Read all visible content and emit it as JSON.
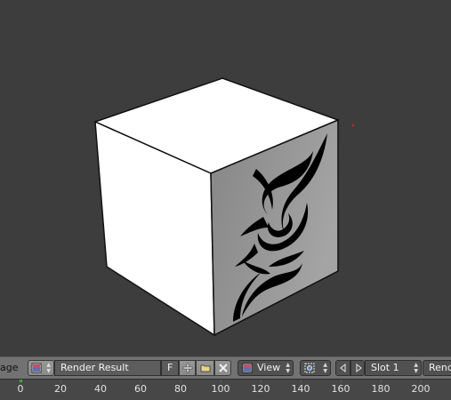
{
  "header": {
    "editor_menu_stub": "age",
    "image_name": "Render Result",
    "fake_user_label": "F",
    "view_label": "View",
    "slot_label": "Slot 1",
    "layer_label_stub": "Rende"
  },
  "timeline": {
    "ticks": [
      "0",
      "20",
      "40",
      "60",
      "80",
      "100",
      "120",
      "140",
      "160",
      "180",
      "200"
    ],
    "current_frame": 1
  },
  "icons": {
    "image_type": "image-icon",
    "new": "plus-icon",
    "open": "folder-icon",
    "unlink": "x-icon",
    "view_type": "image-icon",
    "pivot": "target-icon",
    "prev": "left-arrow-icon",
    "next": "right-arrow-icon"
  },
  "colors": {
    "background": "#3d3d3d",
    "header": "#727272",
    "timeline": "#474747",
    "playhead": "#35d235"
  }
}
